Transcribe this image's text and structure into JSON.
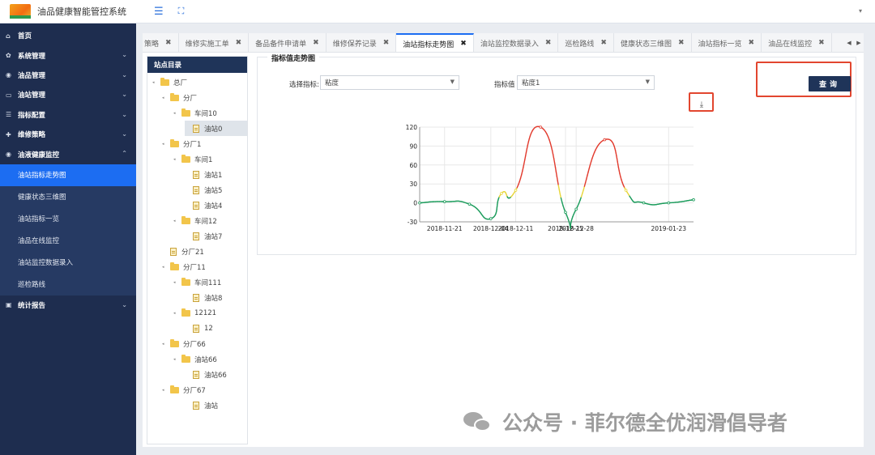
{
  "app": {
    "title": "油品健康智能管控系统"
  },
  "sidebar": {
    "items": [
      {
        "label": "首页",
        "icon": "home-icon",
        "caret": false
      },
      {
        "label": "系统管理",
        "icon": "gear-icon",
        "caret": true
      },
      {
        "label": "油品管理",
        "icon": "drop-icon",
        "caret": true
      },
      {
        "label": "油站管理",
        "icon": "station-icon",
        "caret": true
      },
      {
        "label": "指标配置",
        "icon": "sliders-icon",
        "caret": true
      },
      {
        "label": "维修策略",
        "icon": "tools-icon",
        "caret": true
      },
      {
        "label": "油液健康监控",
        "icon": "monitor-icon",
        "caret": true,
        "expanded": true
      }
    ],
    "submenu": [
      {
        "label": "油站指标走势图",
        "active": true
      },
      {
        "label": "健康状态三维图",
        "active": false
      },
      {
        "label": "油站指标一览",
        "active": false
      },
      {
        "label": "油品在线监控",
        "active": false
      },
      {
        "label": "油站监控数据录入",
        "active": false
      },
      {
        "label": "巡检路线",
        "active": false
      }
    ],
    "last_item": {
      "label": "统计报告",
      "icon": "report-icon",
      "caret": true
    }
  },
  "tabs": [
    {
      "label": "策略",
      "active": false
    },
    {
      "label": "维修实施工单",
      "active": false
    },
    {
      "label": "备品备件申请单",
      "active": false
    },
    {
      "label": "维修保养记录",
      "active": false
    },
    {
      "label": "油站指标走势图",
      "active": true
    },
    {
      "label": "油站监控数据录入",
      "active": false
    },
    {
      "label": "巡检路线",
      "active": false
    },
    {
      "label": "健康状态三维图",
      "active": false
    },
    {
      "label": "油站指标一览",
      "active": false
    },
    {
      "label": "油品在线监控",
      "active": false
    }
  ],
  "tree": {
    "title": "站点目录",
    "nodes": [
      {
        "label": "总厂",
        "type": "folder",
        "level": 0
      },
      {
        "label": "分厂",
        "type": "folder",
        "level": 1
      },
      {
        "label": "车间10",
        "type": "folder",
        "level": 2
      },
      {
        "label": "油站0",
        "type": "file",
        "level": 3,
        "selected": true
      },
      {
        "label": "分厂1",
        "type": "folder",
        "level": 1
      },
      {
        "label": "车间1",
        "type": "folder",
        "level": 2
      },
      {
        "label": "油站1",
        "type": "file",
        "level": 3
      },
      {
        "label": "油站5",
        "type": "file",
        "level": 3
      },
      {
        "label": "油站4",
        "type": "file",
        "level": 3
      },
      {
        "label": "车间12",
        "type": "folder",
        "level": 2
      },
      {
        "label": "油站7",
        "type": "file",
        "level": 3
      },
      {
        "label": "分厂21",
        "type": "file",
        "level": 1
      },
      {
        "label": "分厂11",
        "type": "folder",
        "level": 1
      },
      {
        "label": "车间111",
        "type": "folder",
        "level": 2
      },
      {
        "label": "油站8",
        "type": "file",
        "level": 3
      },
      {
        "label": "12121",
        "type": "folder",
        "level": 2
      },
      {
        "label": "12",
        "type": "file",
        "level": 3
      },
      {
        "label": "分厂66",
        "type": "folder",
        "level": 1
      },
      {
        "label": "油站66",
        "type": "folder",
        "level": 2
      },
      {
        "label": "油站66",
        "type": "file",
        "level": 3
      },
      {
        "label": "分厂67",
        "type": "folder",
        "level": 1
      },
      {
        "label": "油站",
        "type": "file",
        "level": 3
      }
    ]
  },
  "panel": {
    "title": "指标值走势图",
    "select_indicator_label": "选择指标:",
    "select_indicator_value": "粘度",
    "indicator_value_label": "指标值",
    "indicator_value_value": "粘度1",
    "query_label": "查询",
    "highlight_color": "#e2462f"
  },
  "chart_data": {
    "type": "line",
    "x": [
      "2018-11-14",
      "2018-11-21",
      "2018-11-28",
      "2018-12-04",
      "2018-12-07",
      "2018-12-11",
      "2018-12-18",
      "2018-12-25",
      "2018-12-28",
      "2019-01-05",
      "2019-01-11",
      "2019-01-16",
      "2019-01-23",
      "2019-01-30"
    ],
    "values": [
      0,
      2,
      -2,
      -25,
      15,
      20,
      120,
      -15,
      -10,
      100,
      20,
      0,
      0,
      5
    ],
    "xticks": [
      "2018-11-21",
      "2018-12-04",
      "2018-12-11",
      "2018-12-25",
      "2018-12-28",
      "2019-01-23"
    ],
    "yticks": [
      120,
      90,
      60,
      30,
      0,
      -30
    ],
    "ylim": [
      -30,
      120
    ],
    "grid": true,
    "colors": {
      "low": "#1c9c5c",
      "mid": "#e8d63a",
      "high": "#e23b2e"
    }
  },
  "watermark": {
    "text": "公众号 · 菲尔德全优润滑倡导者"
  }
}
